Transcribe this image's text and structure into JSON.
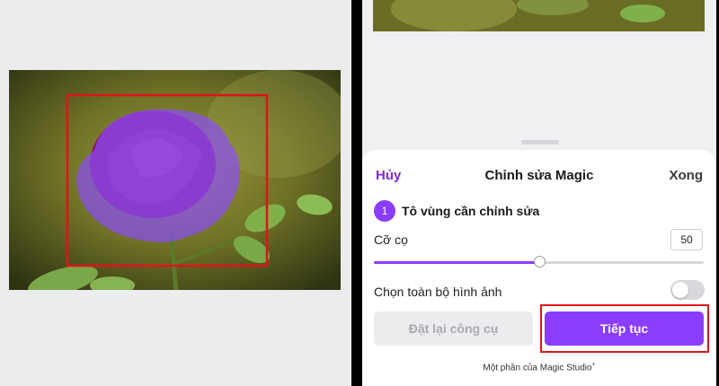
{
  "editor": {
    "cancel": "Hủy",
    "title": "Chỉnh sửa Magic",
    "done": "Xong",
    "step_number": "1",
    "step_label": "Tô vùng cần chỉnh sửa",
    "brush_size_label": "Cỡ cọ",
    "brush_size_value": "50",
    "brush_slider_fraction": 0.5,
    "select_all_label": "Chọn toàn bộ hình ảnh",
    "select_all_enabled": false,
    "reset_button": "Đặt lại công cụ",
    "continue_button": "Tiếp tục",
    "footer": "Một phần của Magic Studio",
    "footer_mark": "+"
  },
  "colors": {
    "accent": "#8b3dff",
    "link": "#7d2ae8",
    "highlight": "#e0131b"
  },
  "icons": [
    "rose-photo",
    "brush-mask",
    "toggle-switch",
    "slider-thumb",
    "drag-handle"
  ]
}
